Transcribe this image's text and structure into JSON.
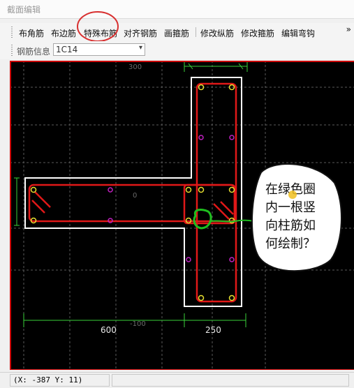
{
  "window": {
    "title": "截面编辑"
  },
  "toolbar": {
    "buttons": [
      "布角筋",
      "布边筋",
      "特殊布筋",
      "对齐钢筋",
      "画箍筋",
      "修改纵筋",
      "修改箍筋",
      "编辑弯钩"
    ],
    "more": "»"
  },
  "rebar_info": {
    "label": "钢筋信息",
    "value": "1C14"
  },
  "canvas": {
    "dims": {
      "top": "300",
      "mid": "0",
      "bottom": "-100",
      "w600": "600",
      "w250": "250"
    },
    "annotation_lines": [
      "在绿色圈",
      "内一根竖",
      "向柱筋如",
      "何绘制？"
    ],
    "colors": {
      "background": "#000000",
      "outline": "#ffffff",
      "stirrup": "#e01818",
      "rebar_corner": "#e8e030",
      "rebar_edge": "#c020c0",
      "dim": "#3ad23a",
      "highlight": "#1fbf1f",
      "callout_circle": "#d83030"
    }
  },
  "status": {
    "coords": "(X: -387 Y: 11)"
  }
}
